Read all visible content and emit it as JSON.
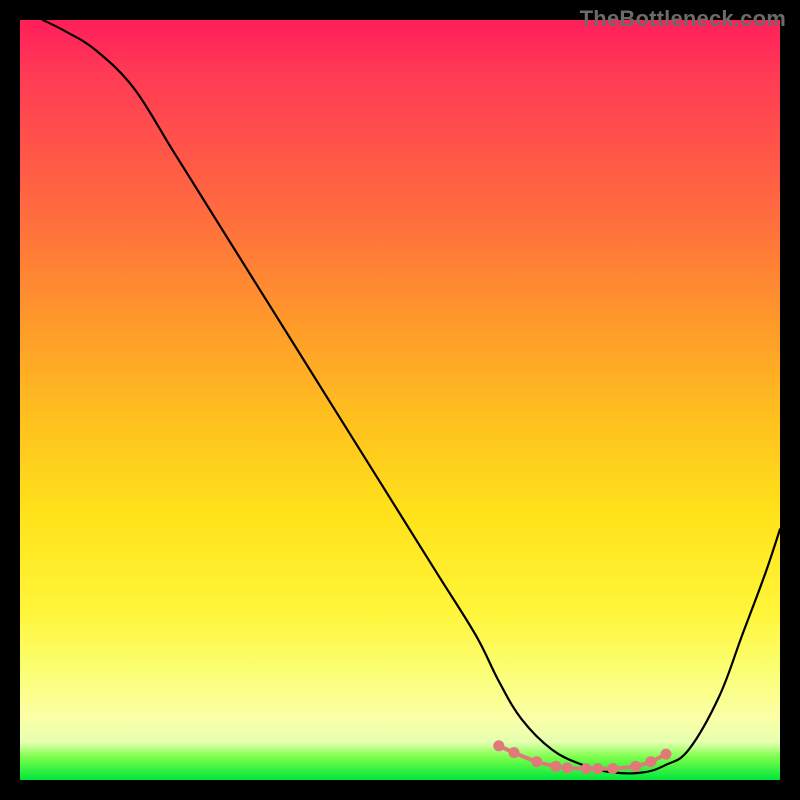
{
  "watermark": "TheBottleneck.com",
  "chart_data": {
    "type": "line",
    "title": "",
    "xlabel": "",
    "ylabel": "",
    "xlim": [
      0,
      100
    ],
    "ylim": [
      0,
      100
    ],
    "series": [
      {
        "name": "curve",
        "x": [
          3,
          6,
          10,
          15,
          20,
          25,
          30,
          35,
          40,
          45,
          50,
          55,
          60,
          63,
          66,
          70,
          74,
          78,
          82,
          85,
          88,
          92,
          95,
          98,
          100
        ],
        "y": [
          100,
          98.5,
          96,
          91,
          83,
          75,
          67,
          59,
          51,
          43,
          35,
          27,
          19,
          13,
          8,
          4,
          2,
          1,
          1,
          2,
          4,
          11,
          19,
          27,
          33
        ]
      }
    ],
    "markers": {
      "name": "valley-dots",
      "color": "#e07a7a",
      "x": [
        63,
        65,
        68,
        70.5,
        72,
        74.5,
        76,
        78,
        81,
        83,
        85
      ],
      "y": [
        4.5,
        3.6,
        2.4,
        1.8,
        1.6,
        1.5,
        1.5,
        1.5,
        1.8,
        2.4,
        3.4
      ]
    }
  }
}
